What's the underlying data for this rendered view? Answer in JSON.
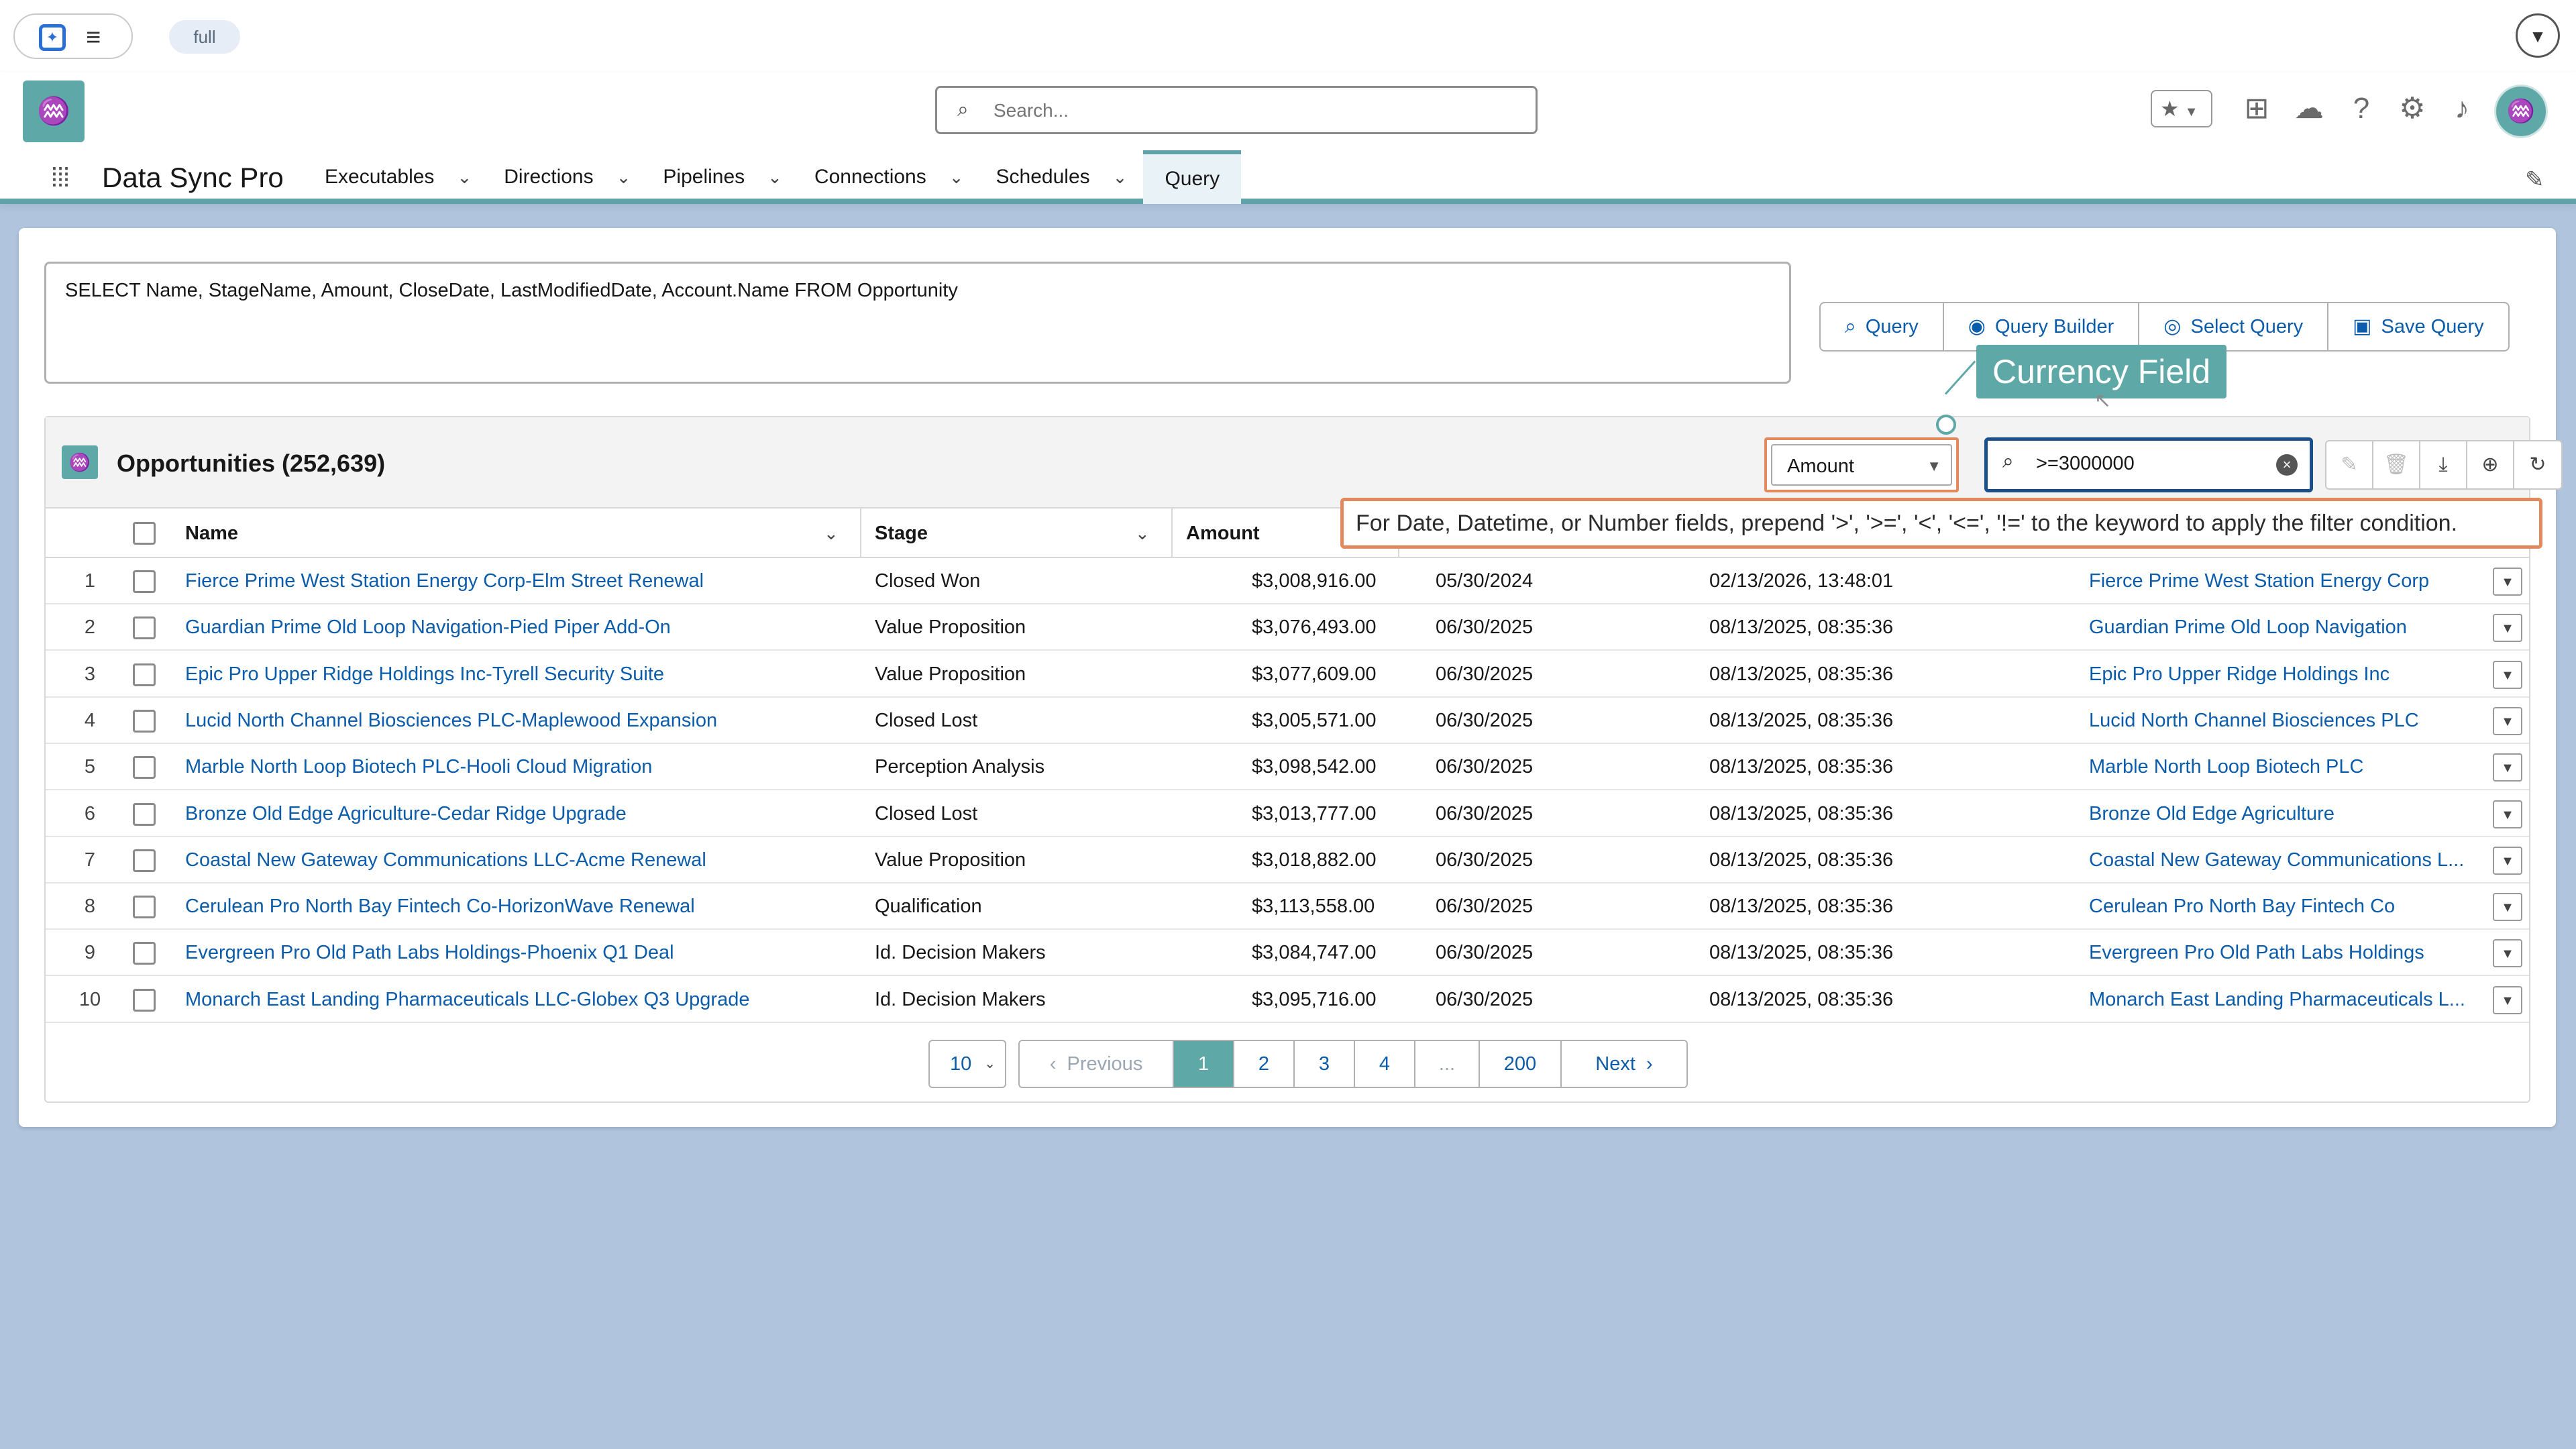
{
  "sysbar": {
    "launcher_icon": "sparkle-icon",
    "menu_icon": "hamburger-icon",
    "env_label": "full",
    "dropdown_icon": "chevron-down-icon"
  },
  "header": {
    "logo_icon": "data-sync-pro-logo",
    "search_placeholder": "Search...",
    "icons": [
      "favorites-star-icon",
      "add-icon",
      "trailhead-icon",
      "help-icon",
      "setup-gear-icon",
      "notifications-bell-icon",
      "avatar"
    ]
  },
  "nav": {
    "app_name": "Data Sync Pro",
    "items": [
      {
        "label": "Executables",
        "has_menu": true
      },
      {
        "label": "Directions",
        "has_menu": true
      },
      {
        "label": "Pipelines",
        "has_menu": true
      },
      {
        "label": "Connections",
        "has_menu": true
      },
      {
        "label": "Schedules",
        "has_menu": true
      },
      {
        "label": "Query",
        "has_menu": false,
        "active": true
      }
    ]
  },
  "query": {
    "text": "SELECT Name, StageName, Amount, CloseDate, LastModifiedDate, Account.Name FROM Opportunity",
    "buttons": [
      "Query",
      "Query Builder",
      "Select Query",
      "Save Query"
    ]
  },
  "results": {
    "title": "Opportunities (252,639)",
    "filter_field": "Amount",
    "filter_value": ">=3000000",
    "columns": [
      "Name",
      "Stage",
      "Amount"
    ],
    "rows": [
      {
        "n": "1",
        "name": "Fierce Prime West Station Energy Corp-Elm Street Renewal",
        "stage": "Closed Won",
        "amount": "$3,008,916.00",
        "close": "05/30/2024",
        "modified": "02/13/2026, 13:48:01",
        "account": "Fierce Prime West Station Energy Corp"
      },
      {
        "n": "2",
        "name": "Guardian Prime Old Loop Navigation-Pied Piper Add-On",
        "stage": "Value Proposition",
        "amount": "$3,076,493.00",
        "close": "06/30/2025",
        "modified": "08/13/2025, 08:35:36",
        "account": "Guardian Prime Old Loop Navigation"
      },
      {
        "n": "3",
        "name": "Epic Pro Upper Ridge Holdings Inc-Tyrell Security Suite",
        "stage": "Value Proposition",
        "amount": "$3,077,609.00",
        "close": "06/30/2025",
        "modified": "08/13/2025, 08:35:36",
        "account": "Epic Pro Upper Ridge Holdings Inc"
      },
      {
        "n": "4",
        "name": "Lucid North Channel Biosciences PLC-Maplewood Expansion",
        "stage": "Closed Lost",
        "amount": "$3,005,571.00",
        "close": "06/30/2025",
        "modified": "08/13/2025, 08:35:36",
        "account": "Lucid North Channel Biosciences PLC"
      },
      {
        "n": "5",
        "name": "Marble North Loop Biotech PLC-Hooli Cloud Migration",
        "stage": "Perception Analysis",
        "amount": "$3,098,542.00",
        "close": "06/30/2025",
        "modified": "08/13/2025, 08:35:36",
        "account": "Marble North Loop Biotech PLC"
      },
      {
        "n": "6",
        "name": "Bronze Old Edge Agriculture-Cedar Ridge Upgrade",
        "stage": "Closed Lost",
        "amount": "$3,013,777.00",
        "close": "06/30/2025",
        "modified": "08/13/2025, 08:35:36",
        "account": "Bronze Old Edge Agriculture"
      },
      {
        "n": "7",
        "name": "Coastal New Gateway Communications LLC-Acme Renewal",
        "stage": "Value Proposition",
        "amount": "$3,018,882.00",
        "close": "06/30/2025",
        "modified": "08/13/2025, 08:35:36",
        "account": "Coastal New Gateway Communications L..."
      },
      {
        "n": "8",
        "name": "Cerulean Pro North Bay Fintech Co-HorizonWave Renewal",
        "stage": "Qualification",
        "amount": "$3,113,558.00",
        "close": "06/30/2025",
        "modified": "08/13/2025, 08:35:36",
        "account": "Cerulean Pro North Bay Fintech Co"
      },
      {
        "n": "9",
        "name": "Evergreen Pro Old Path Labs Holdings-Phoenix Q1 Deal",
        "stage": "Id. Decision Makers",
        "amount": "$3,084,747.00",
        "close": "06/30/2025",
        "modified": "08/13/2025, 08:35:36",
        "account": "Evergreen Pro Old Path Labs Holdings"
      },
      {
        "n": "10",
        "name": "Monarch East Landing Pharmaceuticals LLC-Globex Q3 Upgrade",
        "stage": "Id. Decision Makers",
        "amount": "$3,095,716.00",
        "close": "06/30/2025",
        "modified": "08/13/2025, 08:35:36",
        "account": "Monarch East Landing Pharmaceuticals L..."
      }
    ]
  },
  "pagination": {
    "page_size": "10",
    "previous": "Previous",
    "pages": [
      "1",
      "2",
      "3",
      "4",
      "...",
      "200"
    ],
    "current": "1",
    "next": "Next"
  },
  "annotations": {
    "callout": "Currency Field",
    "tooltip": "For Date, Datetime, or Number fields, prepend '>', '>=', '<', '<=', '!=' to the keyword to apply the filter condition."
  },
  "colors": {
    "accent_teal": "#5fa8a8",
    "link_blue": "#0b5cab",
    "highlight_orange": "#e28a5d",
    "background": "#b0c4de"
  }
}
